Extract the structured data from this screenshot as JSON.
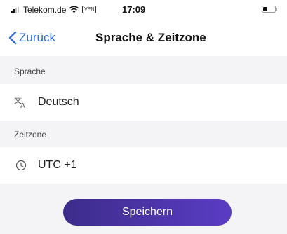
{
  "status_bar": {
    "carrier": "Telekom.de",
    "vpn_badge": "VPN",
    "time": "17:09"
  },
  "nav": {
    "back_label": "Zurück",
    "title": "Sprache & Zeitzone"
  },
  "sections": {
    "language_label": "Sprache",
    "language_value": "Deutsch",
    "language_icon": "translate-icon",
    "timezone_label": "Zeitzone",
    "timezone_value": "UTC +1",
    "timezone_icon": "clock-icon"
  },
  "actions": {
    "save_label": "Speichern"
  },
  "colors": {
    "accent": "#2f6be0",
    "button_start": "#3d2c8a",
    "button_end": "#5a3cc4",
    "background": "#f4f4f6"
  }
}
